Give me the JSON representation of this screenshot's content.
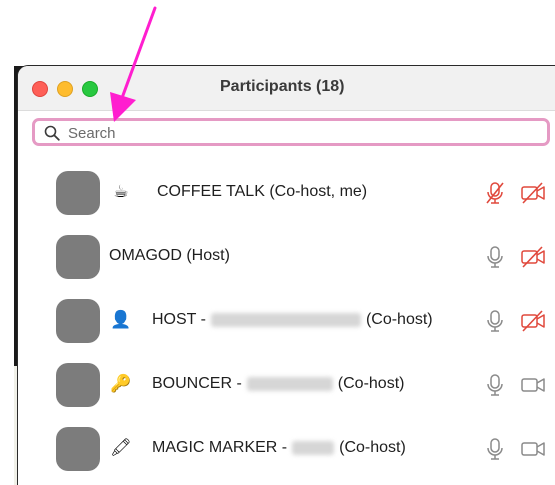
{
  "window": {
    "title": "Participants (18)"
  },
  "search": {
    "placeholder": "Search",
    "value": ""
  },
  "colors": {
    "search_focus_border": "#e59ac4",
    "annotation_arrow": "#ff1ecf",
    "muted_red": "#e0483c",
    "icon_gray": "#8a8a8a"
  },
  "participants": [
    {
      "emoji": "☕",
      "emoji_icon": "coffee-icon",
      "label_prefix": "COFFEE TALK (Co-host, me)",
      "label_suffix": "",
      "mic": "muted",
      "video": "off"
    },
    {
      "emoji": "",
      "emoji_icon": "",
      "label_prefix": "OMAGOD (Host)",
      "label_suffix": "",
      "mic": "on",
      "video": "off"
    },
    {
      "emoji": "👤",
      "emoji_icon": "person-icon",
      "label_prefix": "HOST -",
      "label_suffix": "(Co-host)",
      "mic": "on",
      "video": "off"
    },
    {
      "emoji": "🔑",
      "emoji_icon": "key-icon",
      "label_prefix": "BOUNCER -",
      "label_suffix": "(Co-host)",
      "mic": "on",
      "video": "on"
    },
    {
      "emoji": "🖍",
      "emoji_icon": "crayon-icon",
      "label_prefix": "MAGIC MARKER -",
      "label_suffix": "(Co-host)",
      "mic": "on",
      "video": "on"
    }
  ]
}
